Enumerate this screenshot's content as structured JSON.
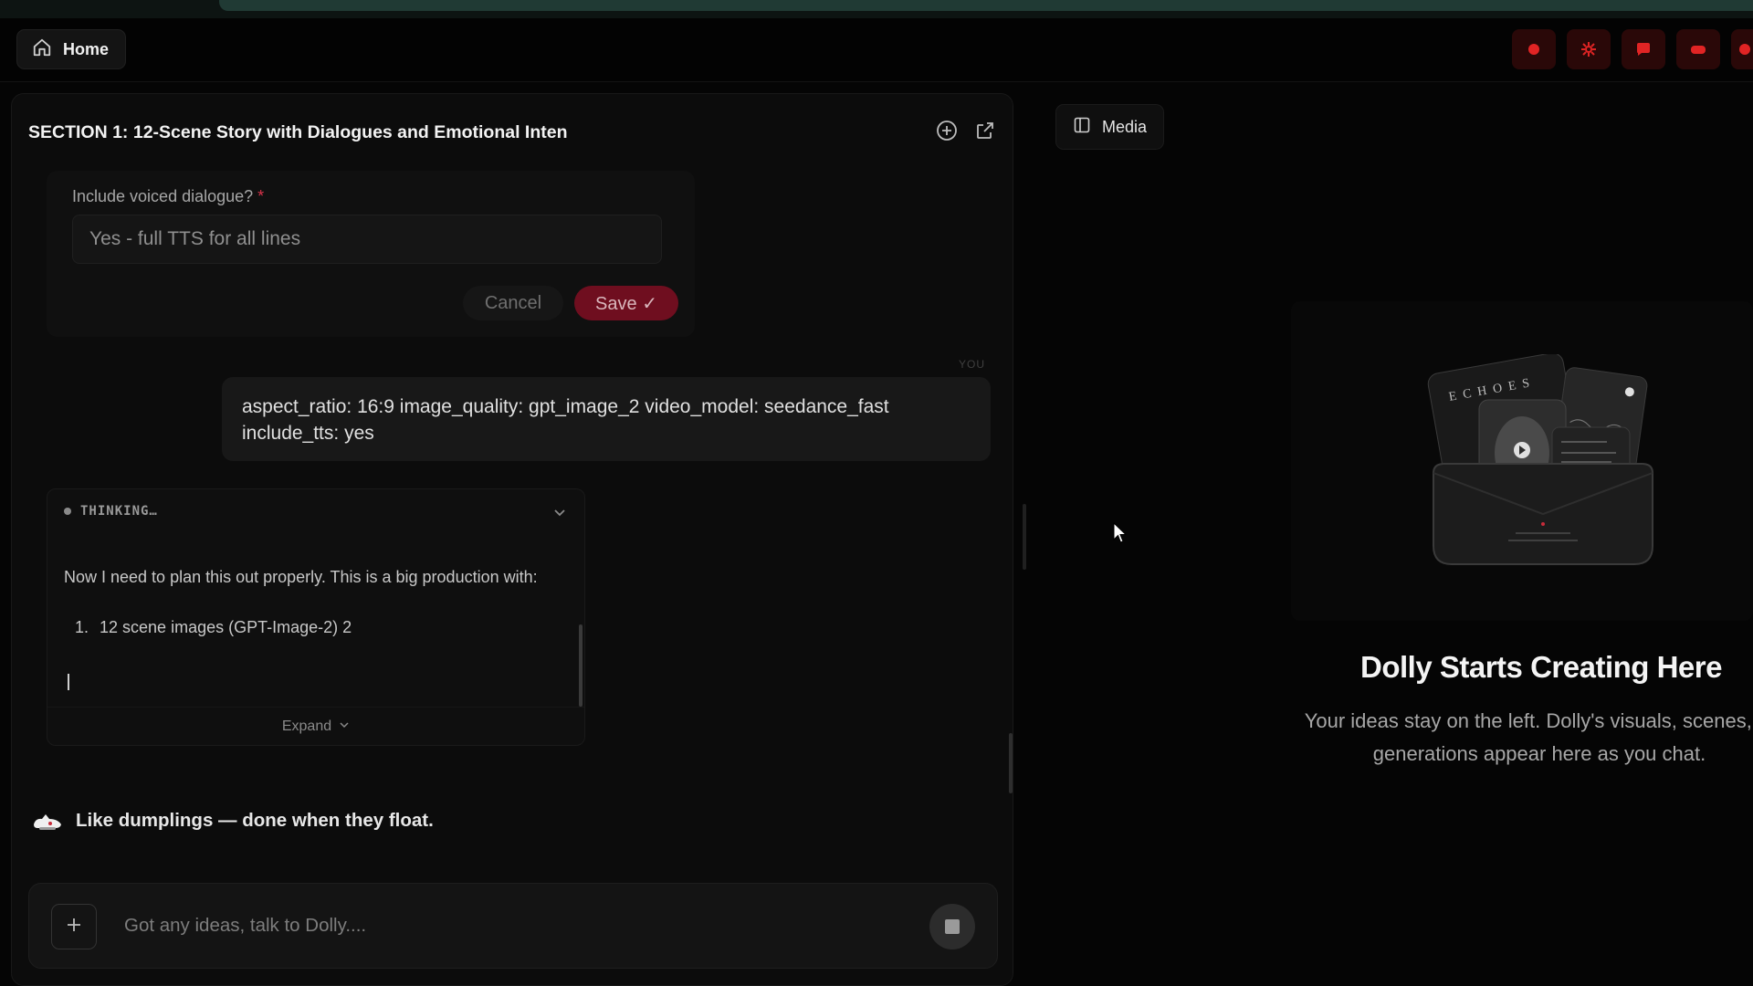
{
  "topbar": {
    "home_label": "Home",
    "icon_names": [
      "record-icon",
      "sparkle-icon",
      "chat-icon",
      "gamepad-icon",
      "record-icon"
    ]
  },
  "section": {
    "title": "SECTION 1: 12-Scene Story with Dialogues and Emotional Inten"
  },
  "form": {
    "label": "Include voiced dialogue?",
    "required_mark": "*",
    "value": "Yes - full TTS for all lines",
    "cancel_label": "Cancel",
    "save_label": "Save ✓"
  },
  "user_message": {
    "sender": "YOU",
    "text": "aspect_ratio: 16:9 image_quality: gpt_image_2 video_model: seedance_fast include_tts: yes"
  },
  "thinking": {
    "label": "THINKING…",
    "text": "Now I need to plan this out properly. This is a big production with:",
    "items": [
      {
        "num": "1.",
        "text": "12 scene images (GPT-Image-2) 2"
      }
    ],
    "expand_label": "Expand"
  },
  "status": {
    "text": "Like dumplings — done when they float."
  },
  "composer": {
    "placeholder": "Got any ideas, talk to Dolly...."
  },
  "media_panel": {
    "tab_label": "Media",
    "empty_title": "Dolly Starts Creating Here",
    "empty_desc_line1": "Your ideas stay on the left. Dolly's visuals, scenes, m",
    "empty_desc_line2": "generations appear here as you chat.",
    "illustration_text": "ECHOES"
  },
  "colors": {
    "accent": "#6f0e1f",
    "required": "#d8334a",
    "top_icon": "#e02424"
  }
}
